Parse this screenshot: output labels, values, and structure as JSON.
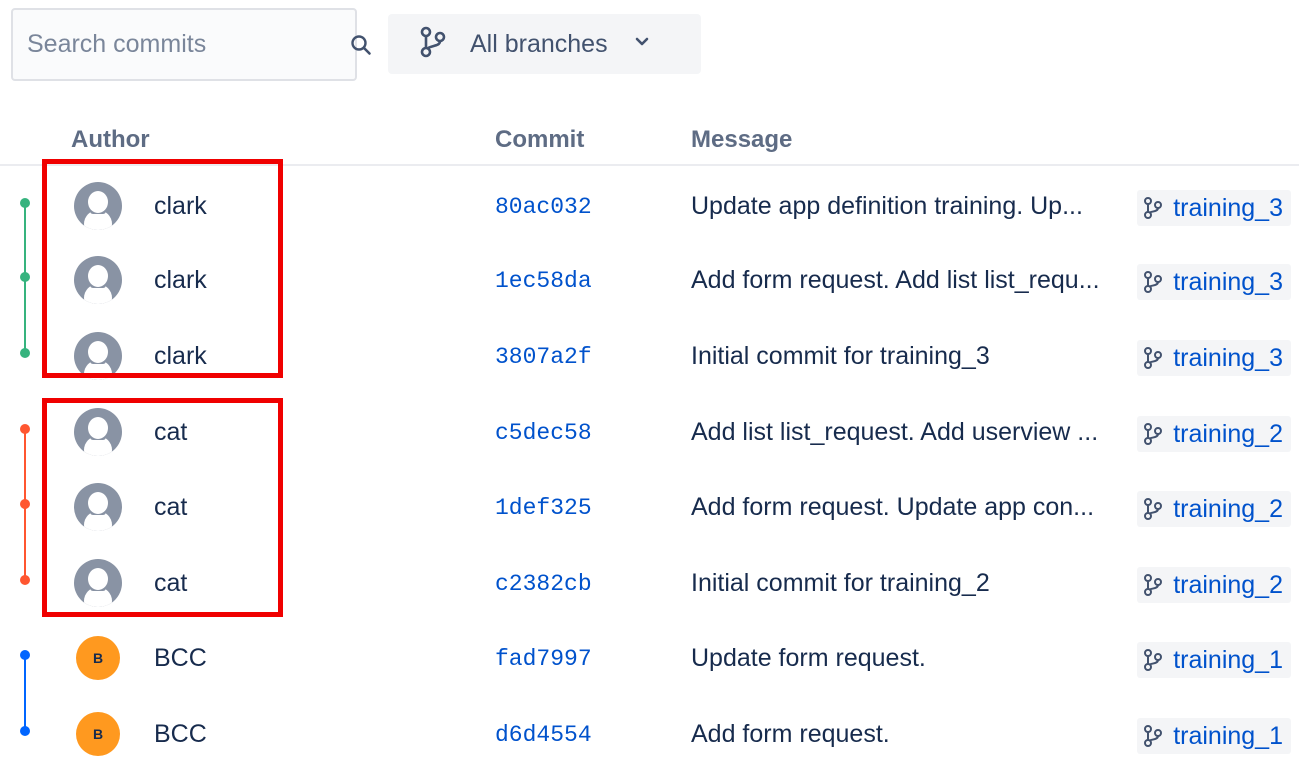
{
  "search": {
    "placeholder": "Search commits",
    "icon": "search-icon"
  },
  "branch_filter": {
    "label": "All branches",
    "icon": "branch-icon",
    "dropdown_icon": "chevron-down-icon"
  },
  "table": {
    "columns": {
      "author": "Author",
      "commit": "Commit",
      "message": "Message"
    },
    "rows": [
      {
        "author": "clark",
        "avatar": "default-avatar",
        "hash": "80ac032",
        "message": "Update app definition training. Up...",
        "branch": "training_3",
        "graph_color": "#36b37e"
      },
      {
        "author": "clark",
        "avatar": "default-avatar",
        "hash": "1ec58da",
        "message": "Add form request. Add list list_requ...",
        "branch": "training_3",
        "graph_color": "#36b37e"
      },
      {
        "author": "clark",
        "avatar": "default-avatar",
        "hash": "3807a2f",
        "message": "Initial commit for training_3",
        "branch": "training_3",
        "graph_color": "#36b37e"
      },
      {
        "author": "cat",
        "avatar": "default-avatar",
        "hash": "c5dec58",
        "message": "Add list list_request. Add userview ...",
        "branch": "training_2",
        "graph_color": "#ff5630"
      },
      {
        "author": "cat",
        "avatar": "default-avatar",
        "hash": "1def325",
        "message": "Add form request. Update app con...",
        "branch": "training_2",
        "graph_color": "#ff5630"
      },
      {
        "author": "cat",
        "avatar": "default-avatar",
        "hash": "c2382cb",
        "message": "Initial commit for training_2",
        "branch": "training_2",
        "graph_color": "#ff5630"
      },
      {
        "author": "BCC",
        "avatar": "B",
        "hash": "fad7997",
        "message": "Update form request.",
        "branch": "training_1",
        "graph_color": "#0065ff"
      },
      {
        "author": "BCC",
        "avatar": "B",
        "hash": "d6d4554",
        "message": "Add form request.",
        "branch": "training_1",
        "graph_color": "#0065ff"
      }
    ]
  },
  "colors": {
    "highlight": "#f00000",
    "link": "#0052cc",
    "avatar_initial_bg": "#ff991f"
  }
}
